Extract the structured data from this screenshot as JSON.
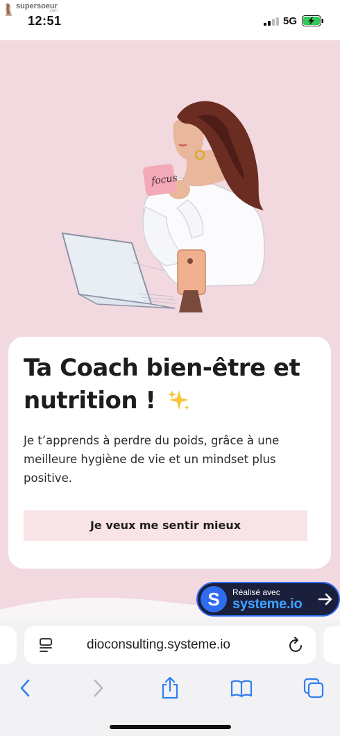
{
  "status_bar": {
    "source_app": "supersoeur",
    "source_app_sub": ".com",
    "time": "12:51",
    "network": "5G"
  },
  "page": {
    "headline_light": "Ta Coach ",
    "headline_bold": "bien-être et nutrition",
    "headline_end": " !",
    "mug_text": "focus",
    "body": "Je t’apprends à perdre du poids, grâce à une meilleure hygiène de vie et un mindset plus positive.",
    "cta_label": "Je veux me sentir mieux"
  },
  "badge": {
    "logo_letter": "S",
    "small_text": "Réalisé avec",
    "brand": "systeme.io"
  },
  "browser": {
    "url": "dioconsulting.systeme.io"
  },
  "icons": {
    "back": "chevron-left-icon",
    "forward": "chevron-right-icon",
    "share": "share-icon",
    "bookmarks": "book-icon",
    "tabs": "tabs-icon",
    "reader": "reader-icon",
    "reload": "reload-icon"
  },
  "colors": {
    "page_background": "#f2d8df",
    "card": "#ffffff",
    "cta_background": "#f8e3e6",
    "badge_background": "#1a1f3c",
    "badge_accent": "#2f6df0",
    "browser_accent": "#2f7ff0"
  }
}
